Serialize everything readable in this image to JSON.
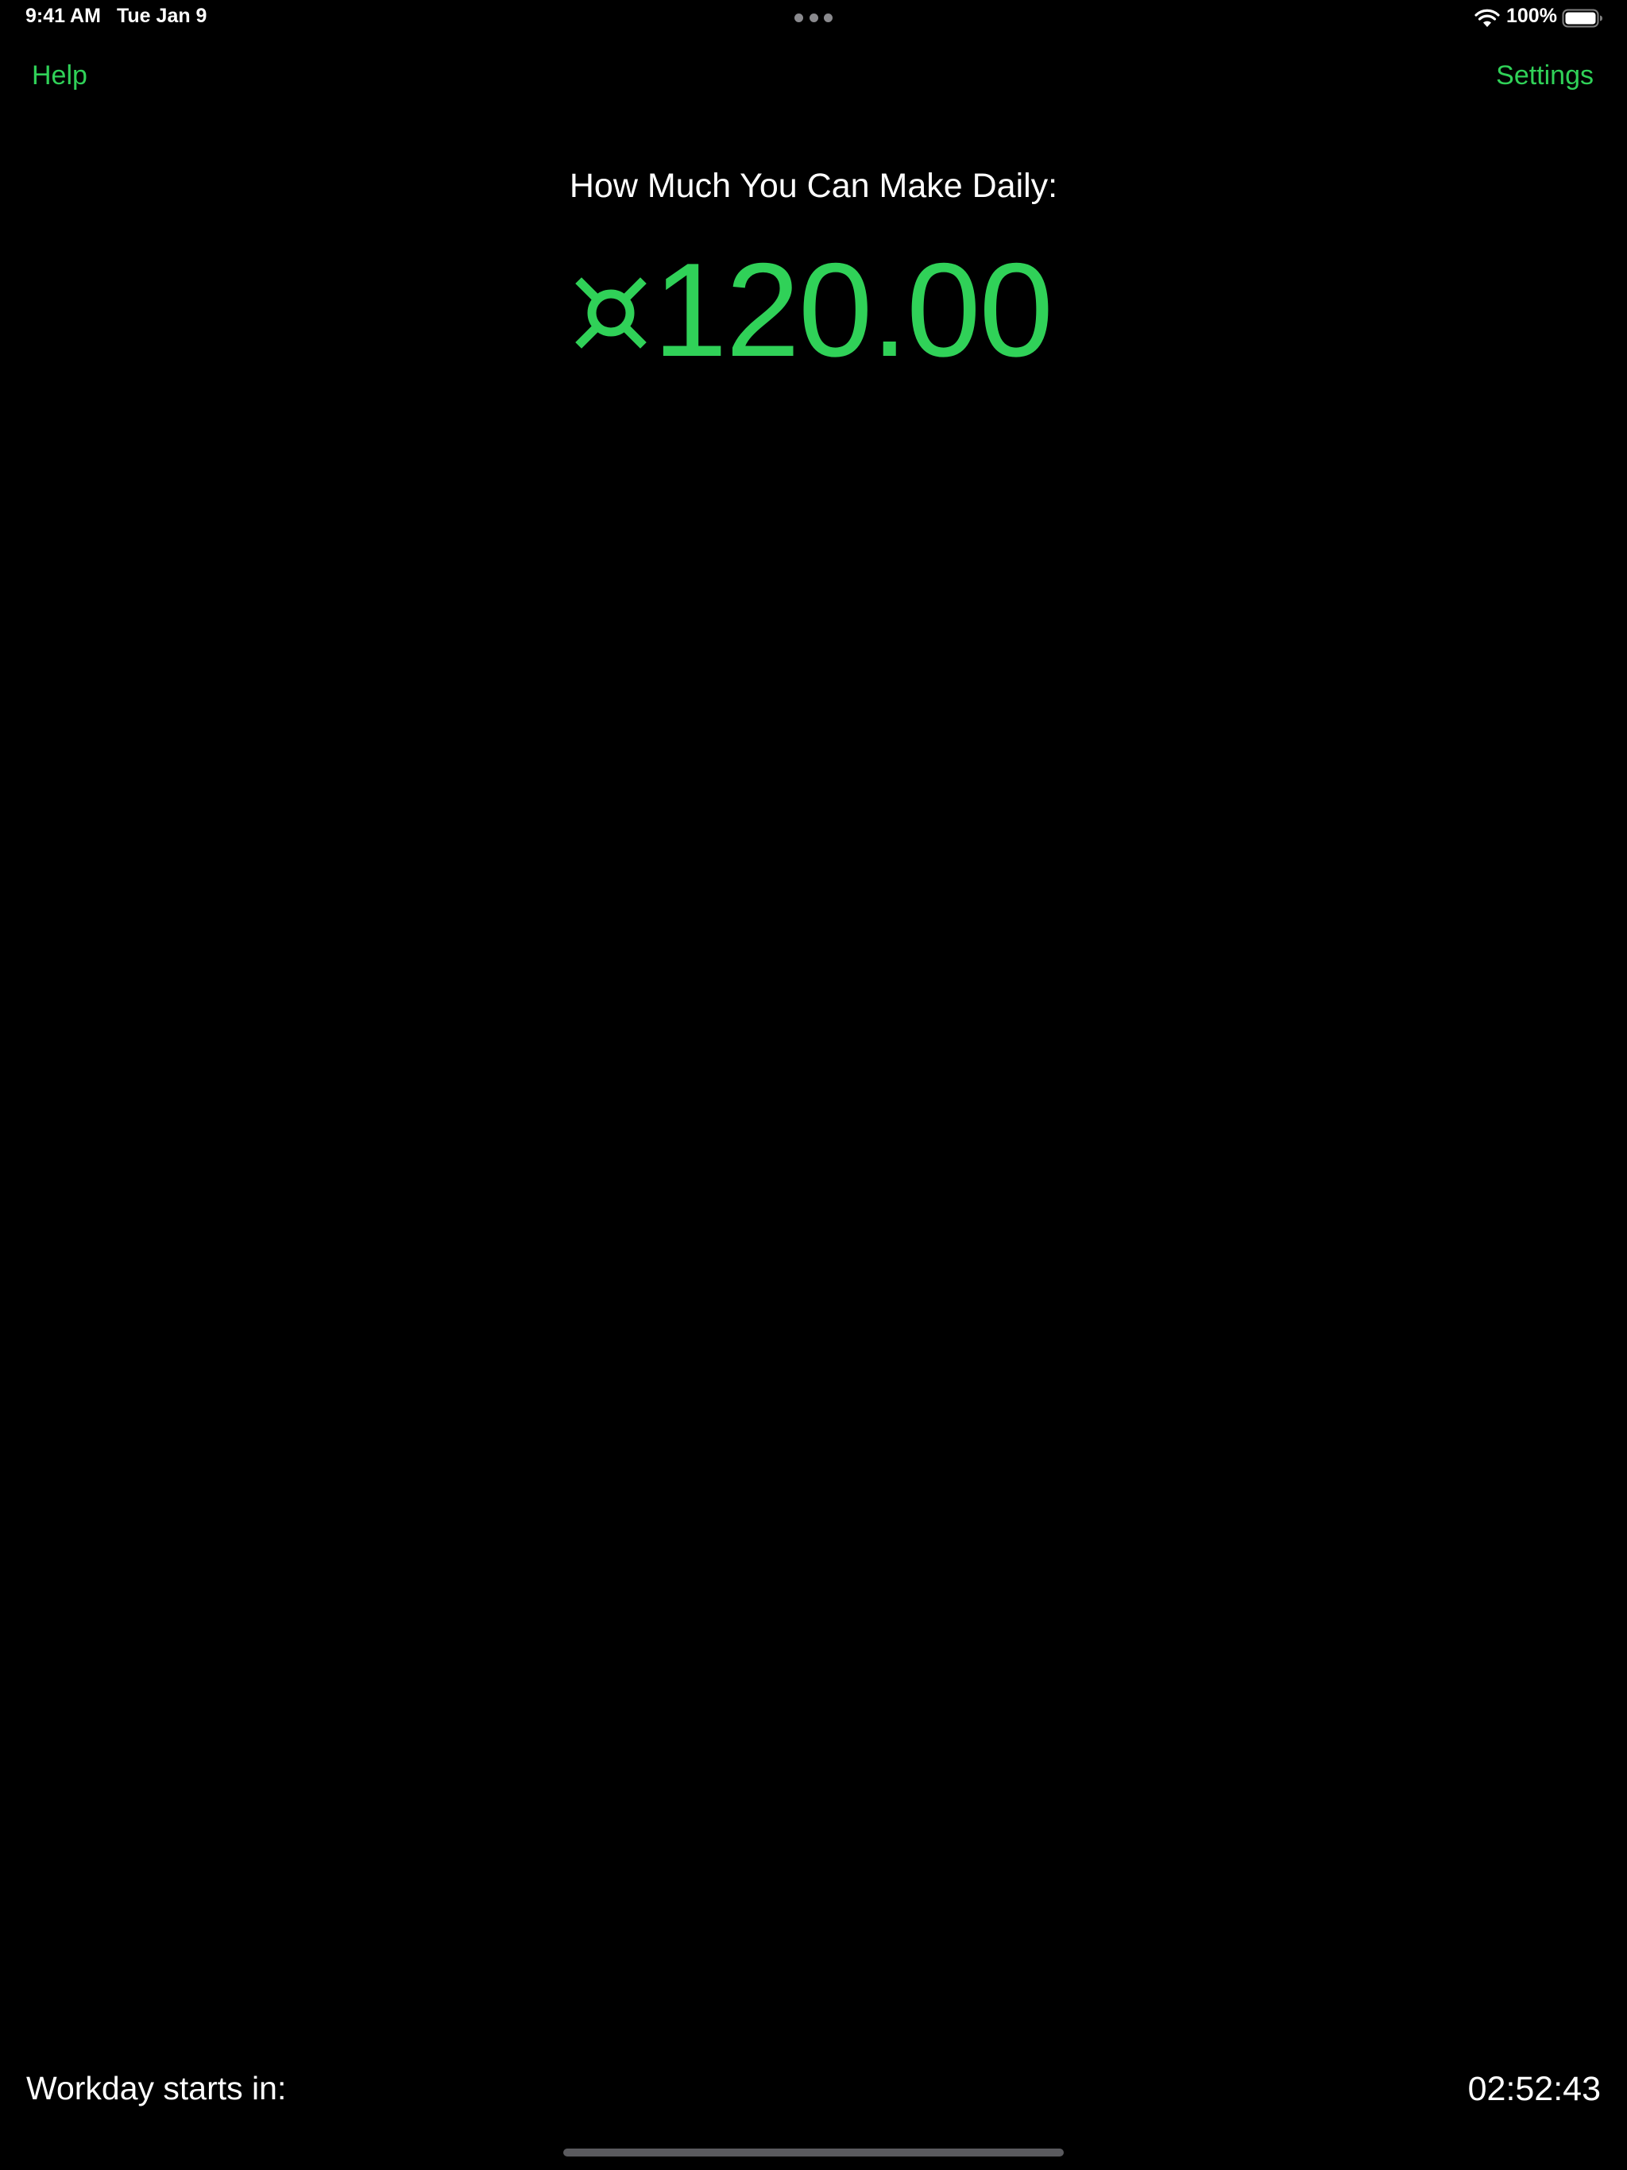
{
  "status_bar": {
    "time": "9:41 AM",
    "date": "Tue Jan 9",
    "battery": "100%"
  },
  "nav": {
    "help_label": "Help",
    "settings_label": "Settings"
  },
  "main": {
    "headline": "How Much You Can Make Daily:",
    "currency_icon": "generic-currency-icon",
    "amount": "120.00"
  },
  "footer": {
    "workday_label": "Workday starts in:",
    "countdown": "02:52:43"
  },
  "colors": {
    "accent": "#30d158",
    "background": "#000000",
    "text": "#ffffff"
  }
}
